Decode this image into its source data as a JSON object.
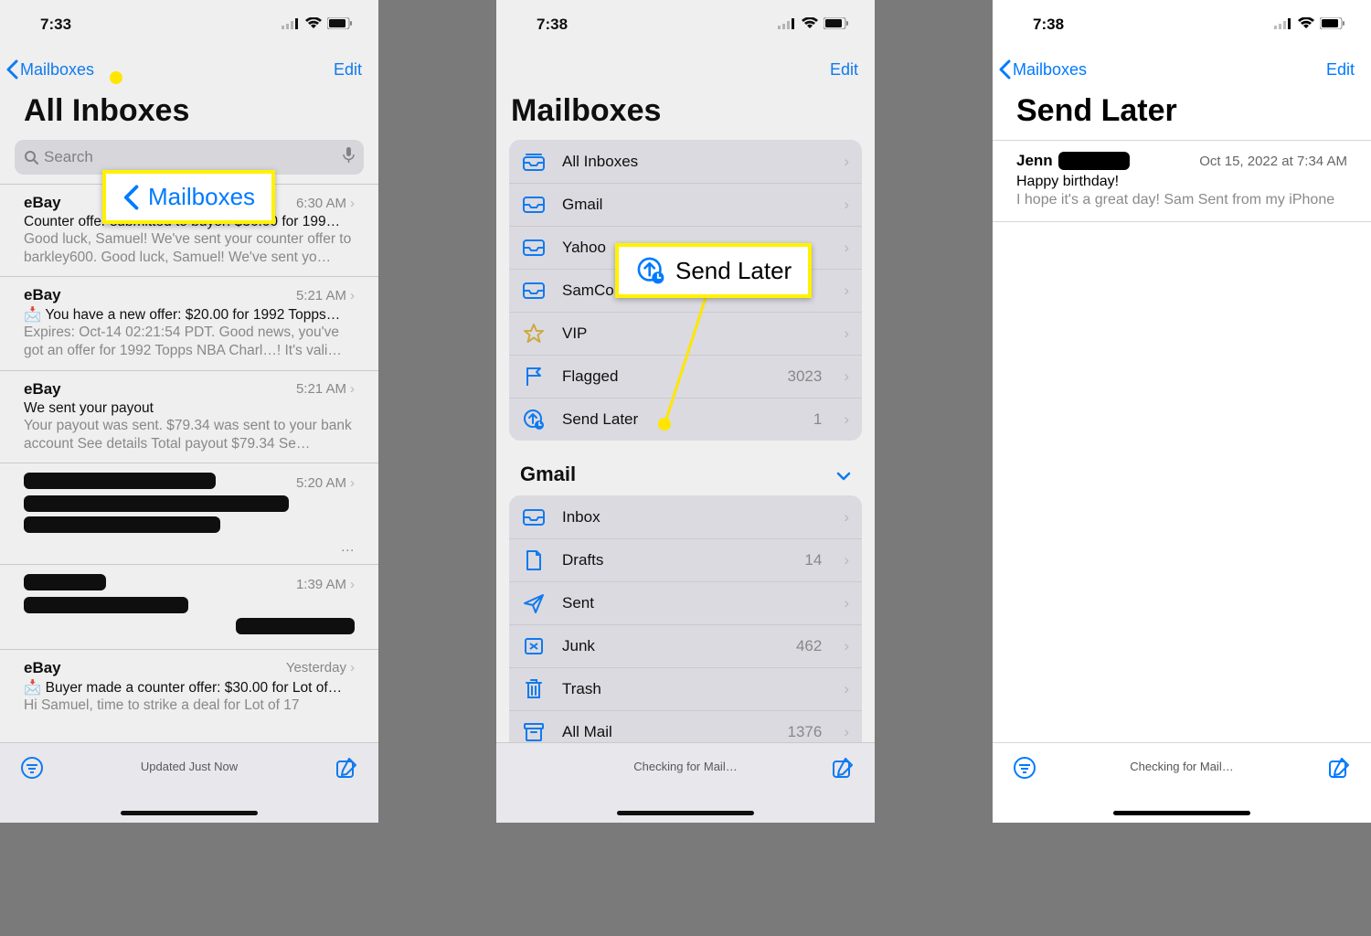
{
  "panel1": {
    "time": "7:33",
    "nav_back": "Mailboxes",
    "edit": "Edit",
    "title": "All Inboxes",
    "search_placeholder": "Search",
    "callout": "Mailboxes",
    "messages": [
      {
        "sender": "eBay",
        "time": "6:30 AM",
        "subject": "Counter offer submitted to buyer: $36.00 for 199…",
        "preview": "Good luck, Samuel! We've sent your counter offer to barkley600. Good luck, Samuel! We've sent yo…"
      },
      {
        "sender": "eBay",
        "time": "5:21 AM",
        "subject": "📩 You have a new offer: $20.00 for 1992 Topps…",
        "preview": "Expires: Oct-14 02:21:54 PDT. Good news, you've got an offer for 1992 Topps NBA Charl…! It's vali…"
      },
      {
        "sender": "eBay",
        "time": "5:21 AM",
        "subject": "We sent your payout",
        "preview": "Your payout was sent. $79.34 was sent to your bank account See details Total payout $79.34 Se…"
      },
      {
        "sender": "",
        "time": "5:20 AM",
        "subject": "",
        "preview": "…"
      },
      {
        "sender": "",
        "time": "1:39 AM",
        "subject": "",
        "preview": ""
      },
      {
        "sender": "eBay",
        "time": "Yesterday",
        "subject": "📩 Buyer made a counter offer: $30.00 for Lot of…",
        "preview": "Hi Samuel, time to strike a deal for Lot of 17"
      }
    ],
    "bottom_status": "Updated Just Now"
  },
  "panel2": {
    "time": "7:38",
    "edit": "Edit",
    "title": "Mailboxes",
    "callout": "Send Later",
    "top_rows": [
      {
        "icon": "tray-all",
        "label": "All Inboxes",
        "count": ""
      },
      {
        "icon": "tray",
        "label": "Gmail",
        "count": ""
      },
      {
        "icon": "tray",
        "label": "Yahoo",
        "count": ""
      },
      {
        "icon": "tray",
        "label": "SamCo…",
        "count": ""
      },
      {
        "icon": "star",
        "label": "VIP",
        "count": ""
      },
      {
        "icon": "flag",
        "label": "Flagged",
        "count": "3023"
      },
      {
        "icon": "sendlater",
        "label": "Send Later",
        "count": "1"
      }
    ],
    "section": "Gmail",
    "gmail_rows": [
      {
        "icon": "tray",
        "label": "Inbox",
        "count": ""
      },
      {
        "icon": "doc",
        "label": "Drafts",
        "count": "14"
      },
      {
        "icon": "send",
        "label": "Sent",
        "count": ""
      },
      {
        "icon": "junk",
        "label": "Junk",
        "count": "462"
      },
      {
        "icon": "trash",
        "label": "Trash",
        "count": ""
      },
      {
        "icon": "archive",
        "label": "All Mail",
        "count": "1376"
      }
    ],
    "bottom_status": "Checking for Mail…"
  },
  "panel3": {
    "time": "7:38",
    "nav_back": "Mailboxes",
    "edit": "Edit",
    "title": "Send Later",
    "msg": {
      "from": "Jenn",
      "date": "Oct 15, 2022 at 7:34 AM",
      "subject": "Happy birthday!",
      "preview": "I hope it's a great day! Sam Sent from my iPhone"
    },
    "bottom_status": "Checking for Mail…"
  }
}
